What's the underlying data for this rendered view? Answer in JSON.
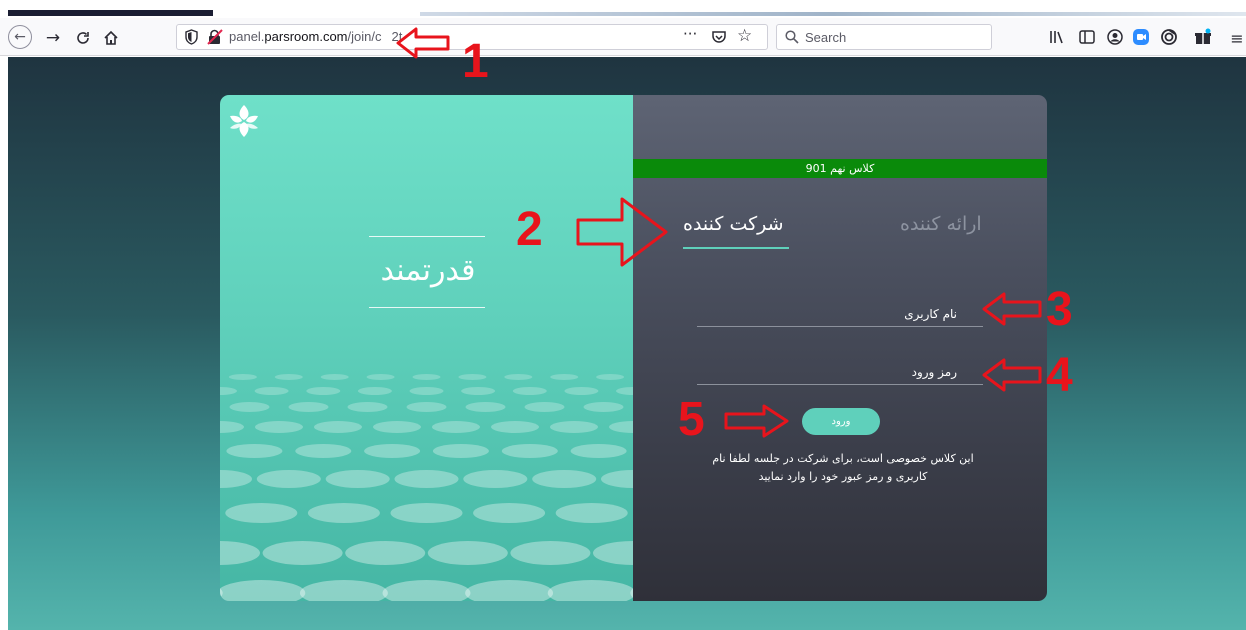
{
  "browser": {
    "url_prefix": "panel.",
    "url_domain": "parsroom.com",
    "url_path": "/join/c",
    "url_suffix": "2t",
    "search_placeholder": "Search"
  },
  "page": {
    "tagline": "قدرتمند",
    "class_name": "کلاس نهم 901",
    "tabs": {
      "presenter": "ارائه کننده",
      "participant": "شرکت کننده"
    },
    "username_label": "نام کاربری",
    "password_label": "رمز ورود",
    "login_button": "ورود",
    "notice_line1": "این کلاس خصوصی است، برای شرکت در جلسه لطفا نام",
    "notice_line2": "کاربری و رمز عبور خود را وارد نمایید"
  },
  "annotations": {
    "n1": "1",
    "n2": "2",
    "n3": "3",
    "n4": "4",
    "n5": "5"
  },
  "colors": {
    "annotation": "#e8141c",
    "accent": "#5fd0bb",
    "banner": "#0a8a0a"
  }
}
